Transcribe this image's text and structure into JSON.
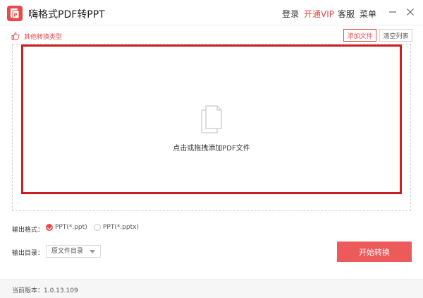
{
  "app": {
    "title": "嗨格式PDF转PPT",
    "brand_color": "#e84a4a"
  },
  "header": {
    "login": "登录",
    "vip": "开通VIP",
    "service": "客服",
    "menu": "菜单"
  },
  "toolbar": {
    "other_types": "其他转换类型",
    "add_file": "添加文件",
    "clear_list": "清空列表"
  },
  "drop_zone": {
    "hint": "点击或拖拽添加PDF文件",
    "icon": "document-icon"
  },
  "output": {
    "format_label": "输出格式：",
    "formats": [
      {
        "label": "PPT(*.ppt)",
        "selected": true
      },
      {
        "label": "PPT(*.pptx)",
        "selected": false
      }
    ],
    "dir_label": "输出目录：",
    "dir_value": "原文件目录",
    "start_button": "开始转换"
  },
  "footer": {
    "version": "当前版本：1.0.13.109"
  },
  "colors": {
    "accent": "#e84a4a",
    "drop_border": "#cc1f1f",
    "start_button": "#ec5a5a"
  }
}
